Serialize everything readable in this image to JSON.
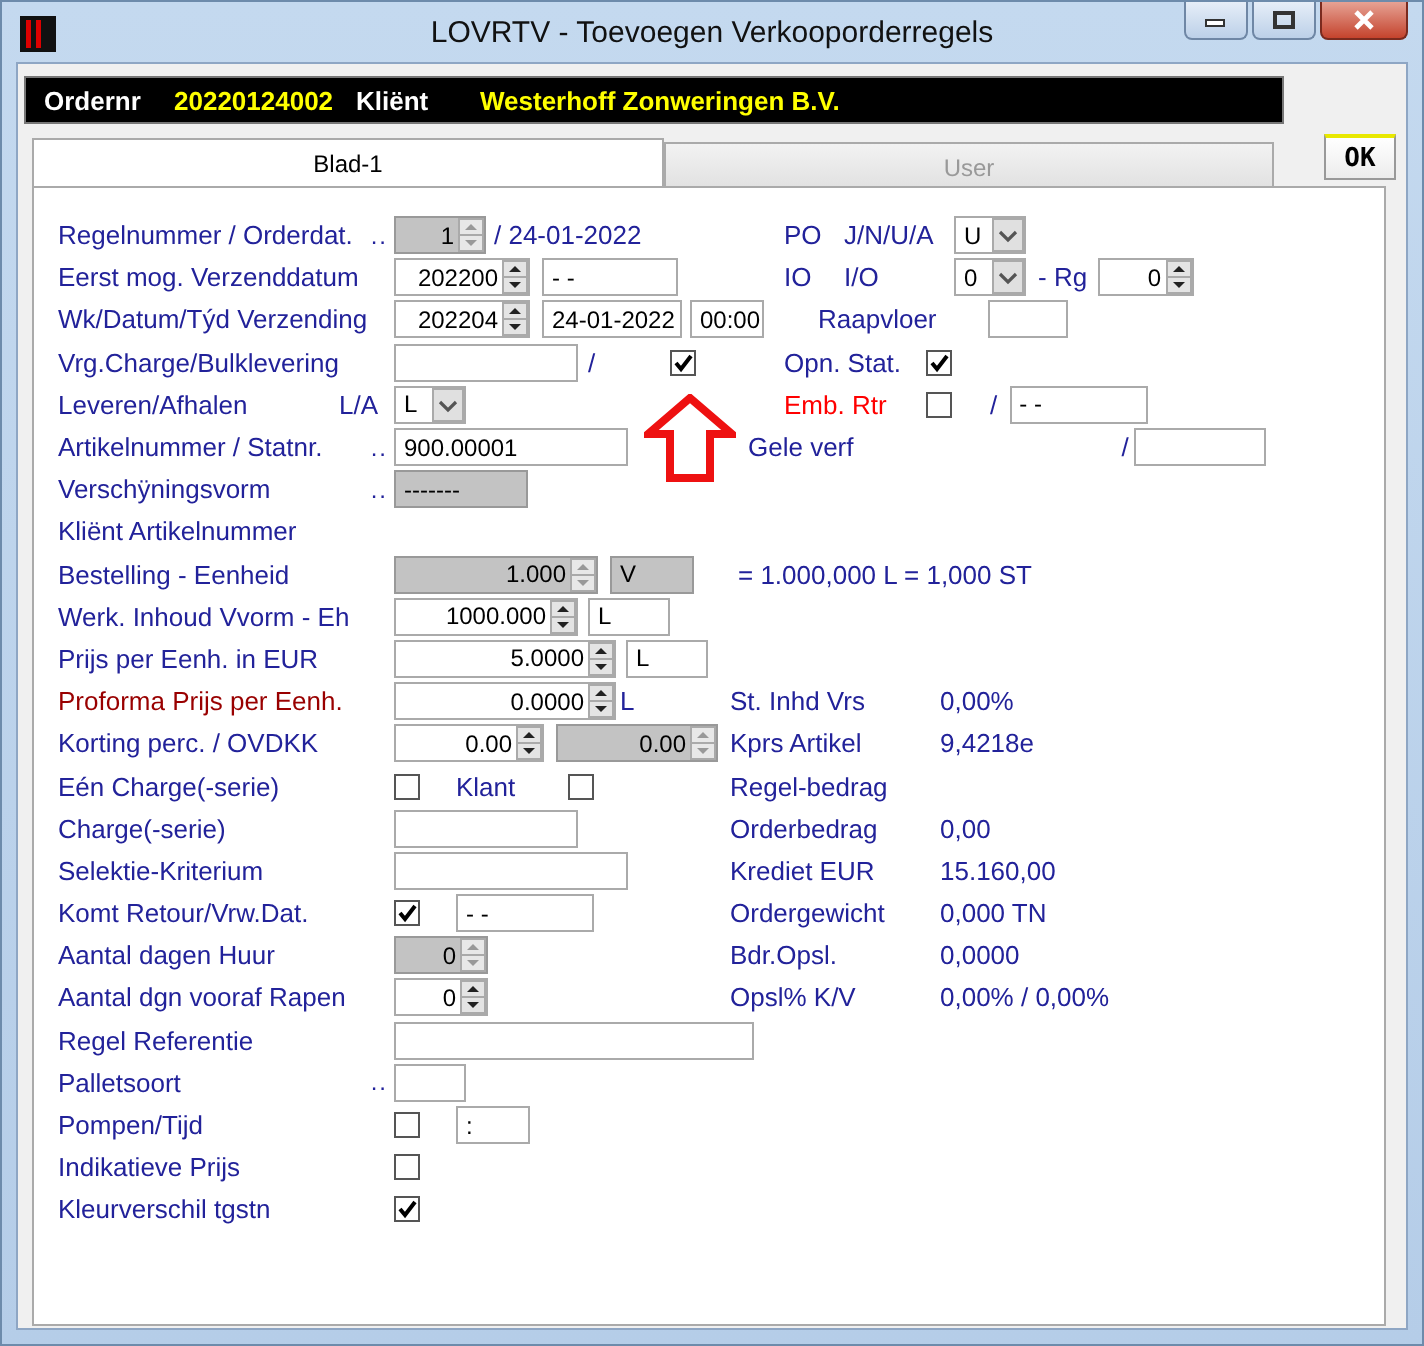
{
  "window": {
    "title": "LOVRTV - Toevoegen Verkooporderregels"
  },
  "order_bar": [
    {
      "kind": "label",
      "text": "Ordernr"
    },
    {
      "kind": "value",
      "text": "20220124002"
    },
    {
      "kind": "label",
      "text": "Kliënt"
    },
    {
      "kind": "value",
      "text": "Westerhoff Zonweringen B.V."
    }
  ],
  "tabs": [
    {
      "label": "Blad-1",
      "selected": true
    },
    {
      "label": "User",
      "selected": false
    }
  ],
  "ok_button": "OK",
  "rows": [
    {
      "label": "Regelnummer / Orderdat.",
      "lead": "..",
      "items": [
        {
          "kind": "spin",
          "value": "1",
          "disabled": true
        },
        {
          "kind": "text",
          "text": "/ 24-01-2022"
        }
      ],
      "right": [
        {
          "kind": "text",
          "text": "PO"
        },
        {
          "kind": "text",
          "text": "J/N/U/A"
        },
        {
          "kind": "select",
          "value": "U"
        }
      ]
    },
    {
      "label": "Eerst mog. Verzenddatum",
      "items": [
        {
          "kind": "spin",
          "value": "202200",
          "disabled": false
        },
        {
          "kind": "field",
          "value": "- -"
        }
      ],
      "right": [
        {
          "kind": "text",
          "text": "IO"
        },
        {
          "kind": "text",
          "text": "I/O"
        },
        {
          "kind": "select",
          "value": "0"
        },
        {
          "kind": "text",
          "text": "- Rg"
        },
        {
          "kind": "spin",
          "value": "0",
          "disabled": false
        }
      ]
    },
    {
      "label": "Wk/Datum/Týd Verzending",
      "items": [
        {
          "kind": "spin",
          "value": "202204",
          "disabled": false
        },
        {
          "kind": "field",
          "value": "24-01-2022"
        },
        {
          "kind": "field",
          "value": "00:00"
        }
      ],
      "right": [
        {
          "kind": "text",
          "text": "Raapvloer"
        },
        {
          "kind": "field"
        }
      ]
    },
    {
      "label": "Vrg.Charge/Bulklevering",
      "items": [
        {
          "kind": "field"
        },
        {
          "kind": "text",
          "text": "/"
        },
        {
          "kind": "check",
          "checked": true
        }
      ],
      "right": [
        {
          "kind": "text",
          "text": "Opn. Stat."
        },
        {
          "kind": "check",
          "checked": true
        }
      ]
    },
    {
      "label": "Leveren/Afhalen",
      "tag": "L/A",
      "items": [
        {
          "kind": "select",
          "value": "L"
        }
      ],
      "right": [
        {
          "kind": "text",
          "text": "Emb. Rtr",
          "color": "#ff0000"
        },
        {
          "kind": "check",
          "checked": false
        },
        {
          "kind": "text",
          "text": "/"
        },
        {
          "kind": "field",
          "value": "- -"
        }
      ]
    },
    {
      "label": "Artikelnummer / Statnr.",
      "lead": "..",
      "items": [
        {
          "kind": "field",
          "value": "900.00001"
        },
        {
          "kind": "text",
          "text": "Gele verf"
        }
      ],
      "right": [
        {
          "kind": "text",
          "text": "/"
        },
        {
          "kind": "field"
        }
      ]
    },
    {
      "label": "Verschÿningsvorm",
      "lead": "..",
      "items": [
        {
          "kind": "field",
          "value": "-------",
          "disabled": true
        }
      ],
      "right": []
    },
    {
      "label": "Kliënt Artikelnummer",
      "items": [],
      "right": []
    },
    {
      "label": "Bestelling - Eenheid",
      "items": [
        {
          "kind": "spin",
          "value": "1.000",
          "disabled": true
        },
        {
          "kind": "field",
          "value": "V",
          "disabled": true
        },
        {
          "kind": "text",
          "text": "= 1.000,000 L  = 1,000 ST"
        }
      ],
      "right": []
    },
    {
      "label": "Werk. Inhoud Vvorm - Eh",
      "items": [
        {
          "kind": "spin",
          "value": "1000.000",
          "disabled": false
        },
        {
          "kind": "field",
          "value": "L"
        }
      ],
      "right": []
    },
    {
      "label": "Prijs per Eenh. in EUR",
      "items": [
        {
          "kind": "spin",
          "value": "5.0000",
          "disabled": false
        },
        {
          "kind": "field",
          "value": "L"
        }
      ],
      "right": []
    },
    {
      "label": "Proforma Prijs per Eenh.",
      "color": "#990000",
      "items": [
        {
          "kind": "spin",
          "value": "0.0000",
          "disabled": false
        },
        {
          "kind": "text",
          "text": "L"
        }
      ],
      "right": [
        {
          "kind": "text",
          "text": "St. Inhd Vrs"
        },
        {
          "kind": "text",
          "text": "0,00%"
        }
      ]
    },
    {
      "label": "Korting perc. / OVDKK",
      "items": [
        {
          "kind": "spin",
          "value": "0.00",
          "disabled": false
        },
        {
          "kind": "spin",
          "value": "0.00",
          "disabled": true
        }
      ],
      "right": [
        {
          "kind": "text",
          "text": "Kprs Artikel"
        },
        {
          "kind": "text",
          "text": "9,4218e"
        }
      ]
    },
    {
      "label": "Eén Charge(-serie)",
      "items": [
        {
          "kind": "check",
          "checked": false
        },
        {
          "kind": "text",
          "text": "Klant"
        },
        {
          "kind": "check",
          "checked": false
        }
      ],
      "right": [
        {
          "kind": "text",
          "text": "Regel-bedrag"
        }
      ]
    },
    {
      "label": "Charge(-serie)",
      "items": [
        {
          "kind": "field"
        }
      ],
      "right": [
        {
          "kind": "text",
          "text": "Orderbedrag"
        },
        {
          "kind": "text",
          "text": "0,00"
        }
      ]
    },
    {
      "label": "Selektie-Kriterium",
      "items": [
        {
          "kind": "field"
        }
      ],
      "right": [
        {
          "kind": "text",
          "text": "Krediet EUR"
        },
        {
          "kind": "text",
          "text": "15.160,00"
        }
      ]
    },
    {
      "label": "Komt Retour/Vrw.Dat.",
      "items": [
        {
          "kind": "check",
          "checked": true
        },
        {
          "kind": "field",
          "value": "- -"
        }
      ],
      "right": [
        {
          "kind": "text",
          "text": "Ordergewicht"
        },
        {
          "kind": "text",
          "text": "0,000 TN"
        }
      ]
    },
    {
      "label": "Aantal dagen Huur",
      "items": [
        {
          "kind": "spin",
          "value": "0",
          "disabled": true
        }
      ],
      "right": [
        {
          "kind": "text",
          "text": "Bdr.Opsl."
        },
        {
          "kind": "text",
          "text": "0,0000"
        }
      ]
    },
    {
      "label": "Aantal dgn vooraf Rapen",
      "items": [
        {
          "kind": "spin",
          "value": "0",
          "disabled": false
        }
      ],
      "right": [
        {
          "kind": "text",
          "text": "Opsl% K/V"
        },
        {
          "kind": "text",
          "text": "0,00% / 0,00%"
        }
      ]
    },
    {
      "label": "Regel Referentie",
      "items": [
        {
          "kind": "field"
        }
      ],
      "right": []
    },
    {
      "label": "Palletsoort",
      "lead": "..",
      "items": [
        {
          "kind": "field"
        }
      ],
      "right": []
    },
    {
      "label": "Pompen/Tijd",
      "items": [
        {
          "kind": "check",
          "checked": false
        },
        {
          "kind": "field",
          "value": ":"
        }
      ],
      "right": []
    },
    {
      "label": "Indikatieve Prijs",
      "items": [
        {
          "kind": "check",
          "checked": false
        }
      ],
      "right": []
    },
    {
      "label": "Kleurverschil tgstn",
      "items": [
        {
          "kind": "check",
          "checked": true
        }
      ],
      "right": []
    }
  ]
}
